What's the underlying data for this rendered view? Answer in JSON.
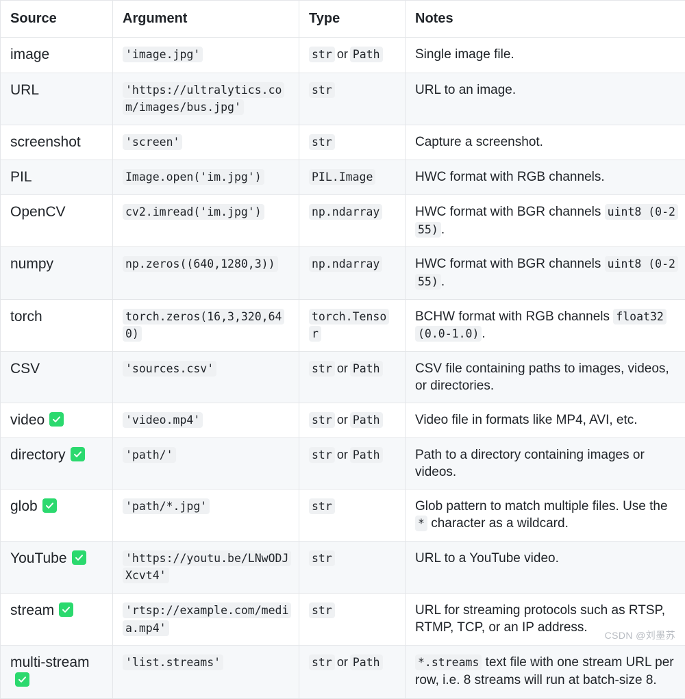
{
  "table": {
    "columns": [
      "Source",
      "Argument",
      "Type",
      "Notes"
    ],
    "rows": [
      {
        "source": "image",
        "check": false,
        "argument": "'image.jpg'",
        "type_parts": [
          {
            "kind": "code",
            "text": "str"
          },
          {
            "kind": "text",
            "text": "or"
          },
          {
            "kind": "code",
            "text": "Path"
          }
        ],
        "notes_parts": [
          {
            "kind": "text",
            "text": "Single image file."
          }
        ]
      },
      {
        "source": "URL",
        "check": false,
        "argument": "'https://ultralytics.com/images/bus.jpg'",
        "type_parts": [
          {
            "kind": "code",
            "text": "str"
          }
        ],
        "notes_parts": [
          {
            "kind": "text",
            "text": "URL to an image."
          }
        ]
      },
      {
        "source": "screenshot",
        "check": false,
        "argument": "'screen'",
        "type_parts": [
          {
            "kind": "code",
            "text": "str"
          }
        ],
        "notes_parts": [
          {
            "kind": "text",
            "text": "Capture a screenshot."
          }
        ]
      },
      {
        "source": "PIL",
        "check": false,
        "argument": "Image.open('im.jpg')",
        "type_parts": [
          {
            "kind": "code",
            "text": "PIL.Image"
          }
        ],
        "notes_parts": [
          {
            "kind": "text",
            "text": "HWC format with RGB channels."
          }
        ]
      },
      {
        "source": "OpenCV",
        "check": false,
        "argument": "cv2.imread('im.jpg')",
        "type_parts": [
          {
            "kind": "code",
            "text": "np.ndarray"
          }
        ],
        "notes_parts": [
          {
            "kind": "text",
            "text": "HWC format with BGR channels "
          },
          {
            "kind": "code",
            "text": "uint8 (0-255)"
          },
          {
            "kind": "text",
            "text": "."
          }
        ]
      },
      {
        "source": "numpy",
        "check": false,
        "argument": "np.zeros((640,1280,3))",
        "type_parts": [
          {
            "kind": "code",
            "text": "np.ndarray"
          }
        ],
        "notes_parts": [
          {
            "kind": "text",
            "text": "HWC format with BGR channels "
          },
          {
            "kind": "code",
            "text": "uint8 (0-255)"
          },
          {
            "kind": "text",
            "text": "."
          }
        ]
      },
      {
        "source": "torch",
        "check": false,
        "argument": "torch.zeros(16,3,320,640)",
        "type_parts": [
          {
            "kind": "code",
            "text": "torch.Tensor"
          }
        ],
        "notes_parts": [
          {
            "kind": "text",
            "text": "BCHW format with RGB channels "
          },
          {
            "kind": "code",
            "text": "float32 (0.0-1.0)"
          },
          {
            "kind": "text",
            "text": "."
          }
        ]
      },
      {
        "source": "CSV",
        "check": false,
        "argument": "'sources.csv'",
        "type_parts": [
          {
            "kind": "code",
            "text": "str"
          },
          {
            "kind": "text",
            "text": "or"
          },
          {
            "kind": "code",
            "text": "Path"
          }
        ],
        "notes_parts": [
          {
            "kind": "text",
            "text": "CSV file containing paths to images, videos, or directories."
          }
        ]
      },
      {
        "source": "video",
        "check": true,
        "argument": "'video.mp4'",
        "type_parts": [
          {
            "kind": "code",
            "text": "str"
          },
          {
            "kind": "text",
            "text": "or"
          },
          {
            "kind": "code",
            "text": "Path"
          }
        ],
        "notes_parts": [
          {
            "kind": "text",
            "text": "Video file in formats like MP4, AVI, etc."
          }
        ]
      },
      {
        "source": "directory",
        "check": true,
        "argument": "'path/'",
        "type_parts": [
          {
            "kind": "code",
            "text": "str"
          },
          {
            "kind": "text",
            "text": "or"
          },
          {
            "kind": "code",
            "text": "Path"
          }
        ],
        "notes_parts": [
          {
            "kind": "text",
            "text": "Path to a directory containing images or videos."
          }
        ]
      },
      {
        "source": "glob",
        "check": true,
        "argument": "'path/*.jpg'",
        "type_parts": [
          {
            "kind": "code",
            "text": "str"
          }
        ],
        "notes_parts": [
          {
            "kind": "text",
            "text": "Glob pattern to match multiple files. Use the "
          },
          {
            "kind": "code",
            "text": "*"
          },
          {
            "kind": "text",
            "text": " character as a wildcard."
          }
        ]
      },
      {
        "source": "YouTube",
        "check": true,
        "argument": "'https://youtu.be/LNwODJXcvt4'",
        "type_parts": [
          {
            "kind": "code",
            "text": "str"
          }
        ],
        "notes_parts": [
          {
            "kind": "text",
            "text": "URL to a YouTube video."
          }
        ]
      },
      {
        "source": "stream",
        "check": true,
        "argument": "'rtsp://example.com/media.mp4'",
        "type_parts": [
          {
            "kind": "code",
            "text": "str"
          }
        ],
        "notes_parts": [
          {
            "kind": "text",
            "text": "URL for streaming protocols such as RTSP, RTMP, TCP, or an IP address."
          }
        ]
      },
      {
        "source": "multi-stream",
        "check": true,
        "argument": "'list.streams'",
        "type_parts": [
          {
            "kind": "code",
            "text": "str"
          },
          {
            "kind": "text",
            "text": "or"
          },
          {
            "kind": "code",
            "text": "Path"
          }
        ],
        "notes_parts": [
          {
            "kind": "code",
            "text": "*.streams"
          },
          {
            "kind": "text",
            "text": " text file with one stream URL per row, i.e. 8 streams will run at batch-size 8."
          }
        ]
      }
    ]
  },
  "watermark": {
    "text": "CSDN @刘墨苏"
  },
  "colors": {
    "check_green": "#2bd96e",
    "row_stripe": "#f6f8fa",
    "border": "#e4e6e9",
    "code_bg": "#eff1f3",
    "text": "#1f2328"
  },
  "icons": {
    "check": "check-icon"
  }
}
